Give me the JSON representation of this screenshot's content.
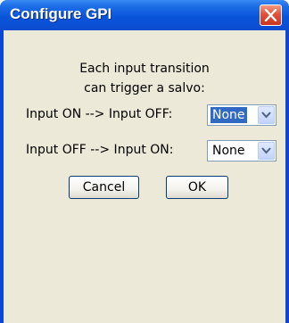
{
  "window": {
    "title": "Configure GPI"
  },
  "message": {
    "line1": "Each input transition",
    "line2": "can trigger a salvo:"
  },
  "rows": [
    {
      "label": "Input ON --> Input OFF:",
      "selected_value": "None",
      "highlighted": true
    },
    {
      "label": "Input OFF --> Input ON:",
      "selected_value": "None",
      "highlighted": false
    }
  ],
  "buttons": {
    "cancel": "Cancel",
    "ok": "OK"
  },
  "icons": {
    "close": "close-icon",
    "dropdown": "chevron-down-icon"
  },
  "colors": {
    "titlebar": "#0a55db",
    "close_button": "#e1523a",
    "client_background": "#ece9d8",
    "selection": "#316ac5"
  }
}
